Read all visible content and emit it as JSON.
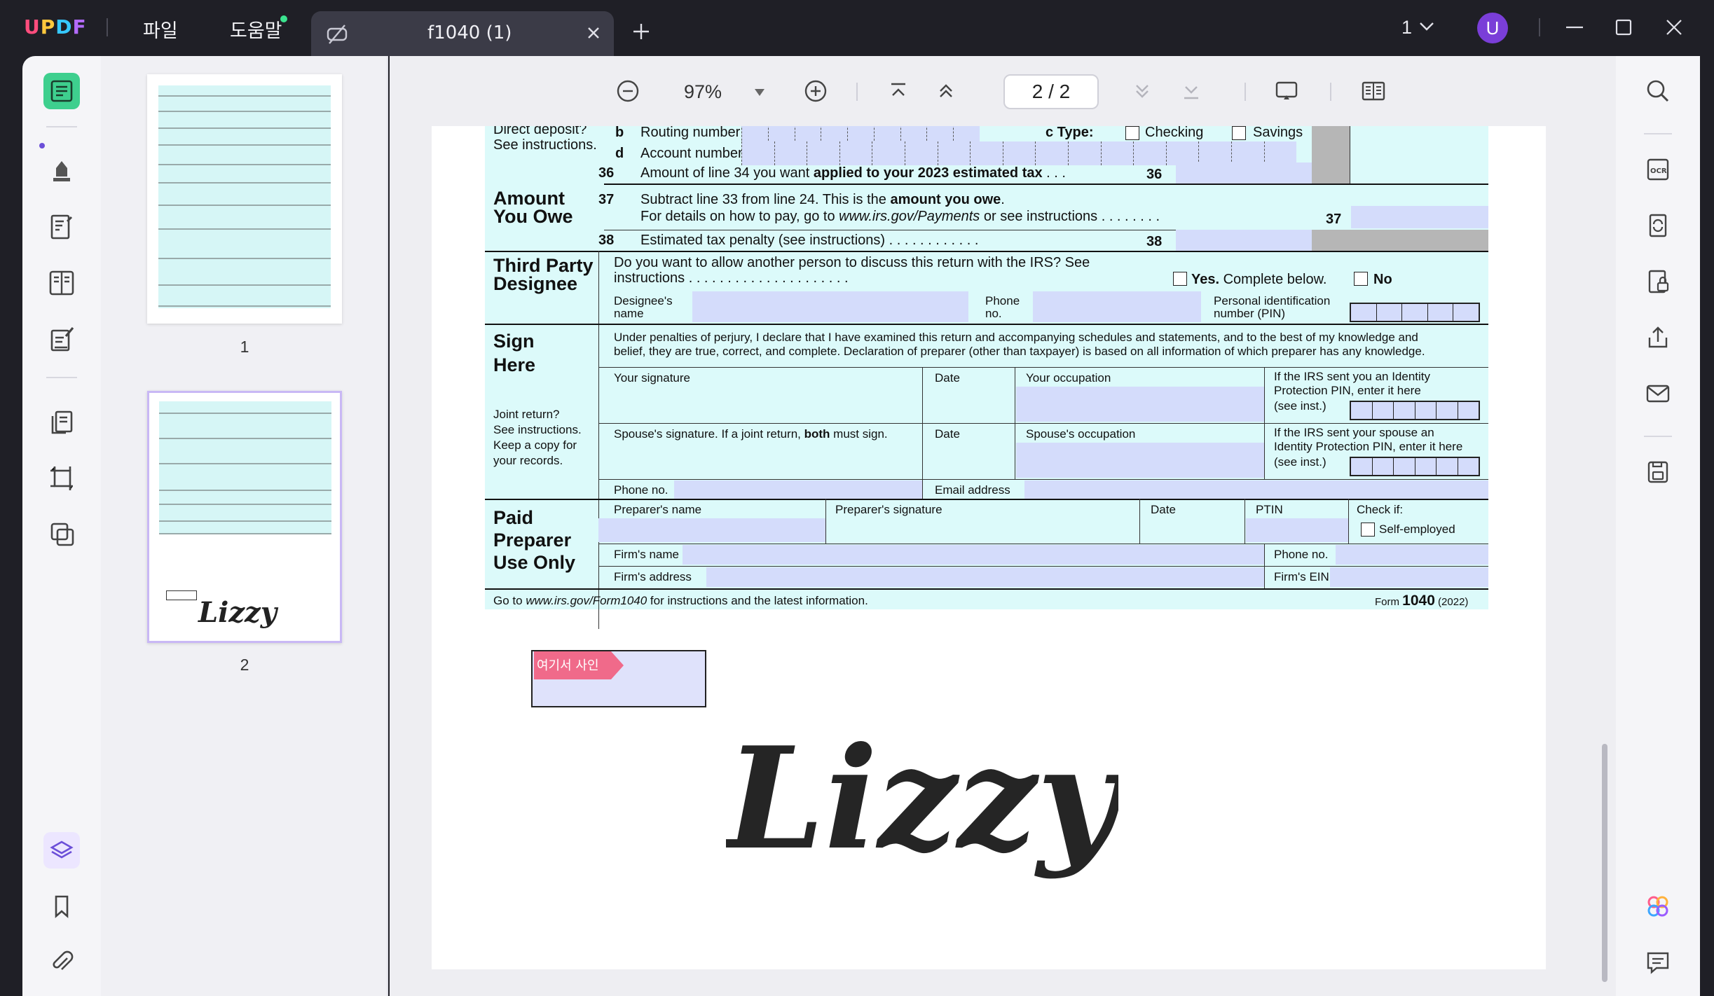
{
  "app": {
    "logo_text": "UPDF"
  },
  "menu": {
    "file": "파일",
    "help": "도움말"
  },
  "tab": {
    "title": "f1040 (1)"
  },
  "page_selector": {
    "value": "1"
  },
  "user": {
    "avatar_letter": "U"
  },
  "toolbar": {
    "zoom": "97%",
    "page_indicator": "2 / 2"
  },
  "thumbnails": [
    {
      "label": "1"
    },
    {
      "label": "2",
      "selected": true,
      "signature": "Lizzy"
    }
  ],
  "form": {
    "direct_deposit": "Direct deposit?",
    "see_instructions": "See instructions.",
    "b": "b",
    "routing": "Routing number",
    "c_type": "c Type:",
    "checking": "Checking",
    "savings": "Savings",
    "d": "d",
    "account": "Account number",
    "l36_num": "36",
    "l36_text_pre": "Amount of line 34 you want ",
    "l36_text_bold": "applied to your 2023 estimated tax",
    "l36_dots": " .   .   .",
    "amount_you_owe_1": "Amount",
    "amount_you_owe_2": "You Owe",
    "l37_num": "37",
    "l37_text_pre": "Subtract line 33 from line 24. This is the ",
    "l37_text_bold": "amount you owe",
    "l37_text_end": ".",
    "l37_text2_pre": "For details on how to pay, go to ",
    "l37_text2_url": "www.irs.gov/Payments",
    "l37_text2_end": " or see instructions .   .   .   .   .   .   .   .",
    "l38_num": "38",
    "l38_text": "Estimated tax penalty (see instructions)  .   .   .   .   .   .   .   .   .   .   .   .",
    "third_party_1": "Third Party",
    "third_party_2": "Designee",
    "tp_q1": "Do  you  want  to  allow  another  person  to  discuss  this  return  with  the  IRS?  See",
    "tp_q2": "instructions   .   .   .   .   .   .   .   .   .   .   .   .   .   .   .   .   .   .   .   .   .",
    "yes_bold": "Yes.",
    "yes_rest": " Complete below.",
    "no": "No",
    "designee_name_1": "Designee's",
    "designee_name_2": "name",
    "phone_1": "Phone",
    "phone_2": "no.",
    "pin_1": "Personal identification",
    "pin_2": "number (PIN)",
    "sign_1": "Sign",
    "sign_2": "Here",
    "perjury_1": "Under penalties of perjury, I declare that I have examined this return and accompanying schedules and statements, and to the best of my knowledge and",
    "perjury_2": "belief, they are true, correct, and complete. Declaration of preparer (other than taxpayer) is based on all information of which preparer has any knowledge.",
    "your_signature": "Your signature",
    "date": "Date",
    "your_occupation": "Your occupation",
    "ip_pin_1": "If the IRS sent you an Identity",
    "ip_pin_2": "Protection PIN, enter it here",
    "ip_pin_3": "(see inst.)",
    "joint_1": "Joint return?",
    "joint_2": "See instructions.",
    "joint_3": "Keep a copy for",
    "joint_4": "your records.",
    "spouse_sig_pre": "Spouse's signature. If a joint return, ",
    "spouse_sig_bold": "both",
    "spouse_sig_end": " must sign.",
    "spouse_occupation": "Spouse's occupation",
    "sp_pin_1": "If the IRS sent your spouse an",
    "sp_pin_2": "Identity Protection PIN, enter it here",
    "sp_pin_3": "(see inst.)",
    "phone_no": "Phone no.",
    "email": "Email address",
    "paid_1": "Paid",
    "paid_2": "Preparer",
    "paid_3": "Use Only",
    "preparer_name": "Preparer's name",
    "preparer_sig": "Preparer's signature",
    "ptin": "PTIN",
    "check_if": "Check if:",
    "self_employed": "Self-employed",
    "firm_name": "Firm's name",
    "firm_address": "Firm's address",
    "firm_phone": "Phone no.",
    "firm_ein": "Firm's EIN",
    "footer_pre": "Go to ",
    "footer_url": "www.irs.gov/Form1040",
    "footer_end": " for instructions and the latest information.",
    "form_label": "Form ",
    "form_num": "1040",
    "form_year": " (2022)"
  },
  "sign_field": {
    "tag": "여기서 사인"
  },
  "signature": {
    "text": "Lizzy"
  },
  "colors": {
    "accent": "#3ecf8e",
    "brand_purple": "#7a3ed8",
    "form_bg": "#dcfafa",
    "field_fill": "#d4dcfb",
    "sign_tag": "#f06a8a"
  }
}
